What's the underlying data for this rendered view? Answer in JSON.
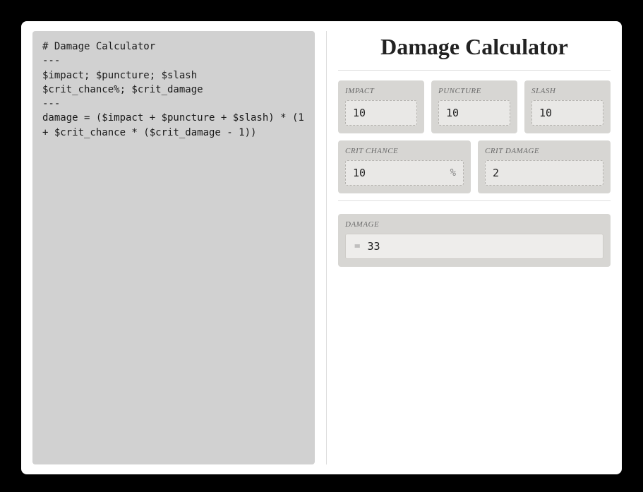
{
  "title": "Damage Calculator",
  "code": "# Damage Calculator\n---\n$impact; $puncture; $slash\n$crit_chance%; $crit_damage\n---\ndamage = ($impact + $puncture + $slash) * (1 + $crit_chance * ($crit_damage - 1))",
  "inputs": {
    "impact": {
      "label": "IMPACT",
      "value": "10"
    },
    "puncture": {
      "label": "PUNCTURE",
      "value": "10"
    },
    "slash": {
      "label": "SLASH",
      "value": "10"
    },
    "crit_chance": {
      "label": "CRIT CHANCE",
      "value": "10",
      "suffix": "%"
    },
    "crit_damage": {
      "label": "CRIT DAMAGE",
      "value": "2"
    }
  },
  "output": {
    "label": "DAMAGE",
    "prefix": "=",
    "value": "33"
  }
}
